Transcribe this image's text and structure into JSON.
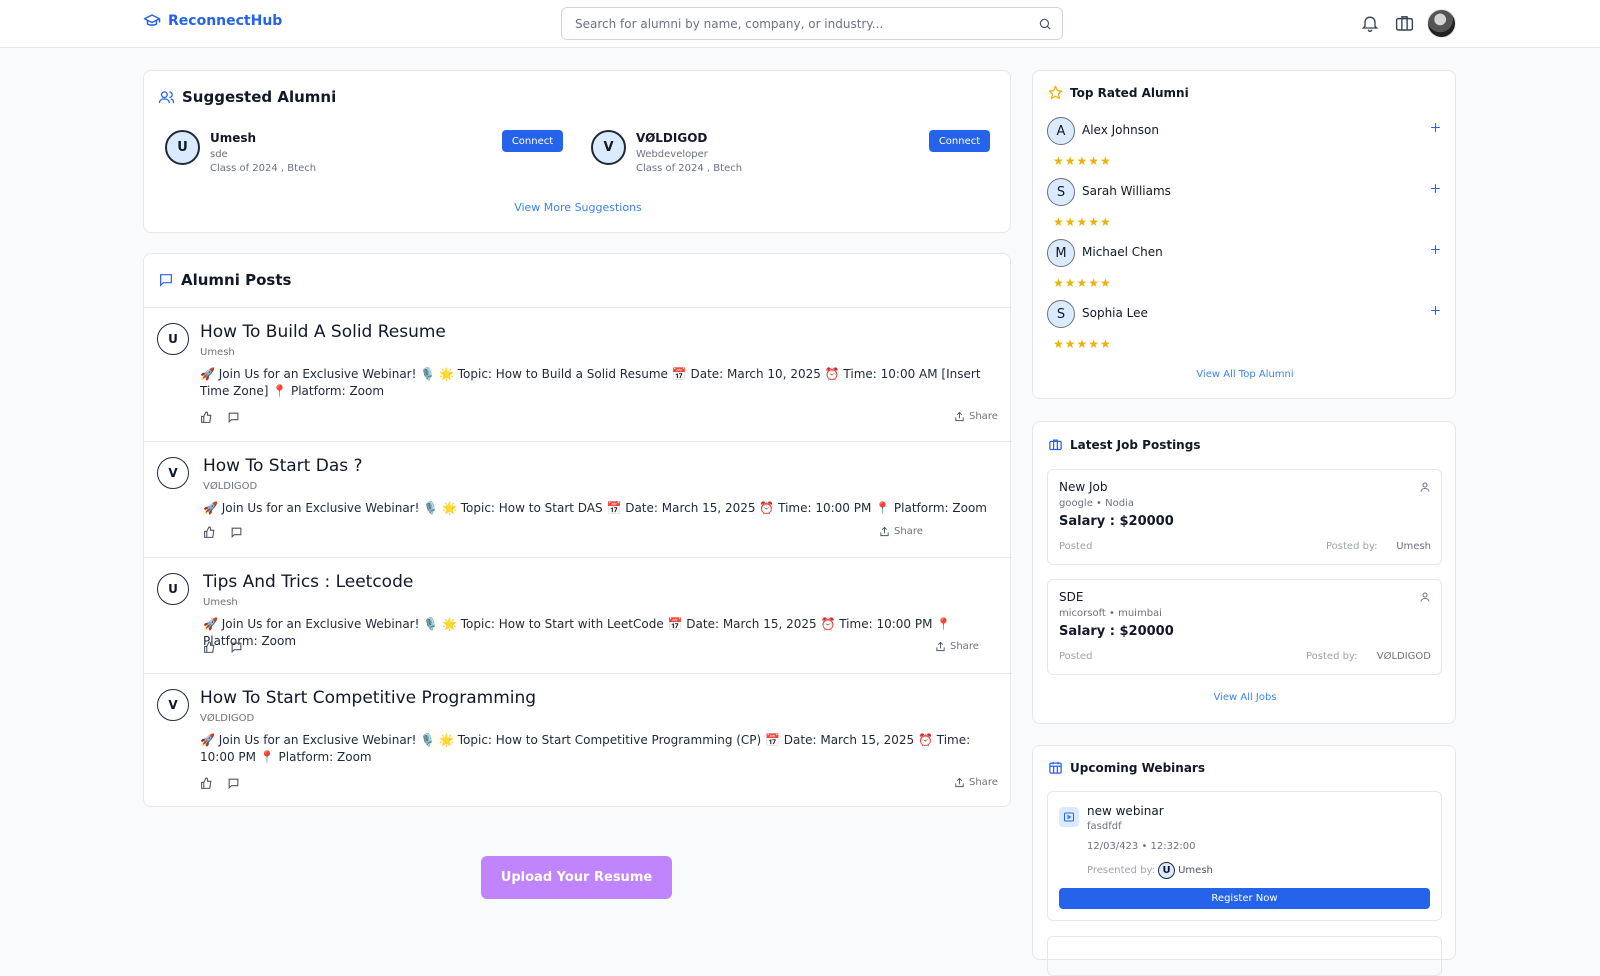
{
  "header": {
    "brand": "ReconnectHub",
    "search_placeholder": "Search for alumni by name, company, or industry..."
  },
  "suggested": {
    "title": "Suggested Alumni",
    "connect_label": "Connect",
    "view_more": "View More Suggestions",
    "items": [
      {
        "initial": "U",
        "name": "Umesh",
        "role": "sde",
        "meta": "Class of 2024 , Btech"
      },
      {
        "initial": "V",
        "name": "VØLDIGOD",
        "role": "Webdeveloper",
        "meta": "Class of 2024 , Btech"
      }
    ]
  },
  "posts": {
    "title": "Alumni Posts",
    "share_label": "Share",
    "items": [
      {
        "initial": "U",
        "title": "How To Build A Solid Resume",
        "author": "Umesh",
        "body": "🚀 Join Us for an Exclusive Webinar! 🎙️ 🌟 Topic: How to Build a Solid Resume 📅 Date: March 10, 2025 ⏰ Time: 10:00 AM [Insert Time Zone] 📍 Platform: Zoom"
      },
      {
        "initial": "V",
        "title": "How To Start Das ?",
        "author": "VØLDIGOD",
        "body": "🚀 Join Us for an Exclusive Webinar! 🎙️ 🌟 Topic: How to Start DAS 📅 Date: March 15, 2025 ⏰ Time: 10:00 PM 📍 Platform: Zoom"
      },
      {
        "initial": "U",
        "title": "Tips And Trics : Leetcode",
        "author": "Umesh",
        "body": "🚀 Join Us for an Exclusive Webinar! 🎙️ 🌟 Topic: How to Start with LeetCode 📅 Date: March 15, 2025 ⏰ Time: 10:00 PM 📍 Platform: Zoom"
      },
      {
        "initial": "V",
        "title": "How To Start Competitive Programming",
        "author": "VØLDIGOD",
        "body": "🚀 Join Us for an Exclusive Webinar! 🎙️ 🌟 Topic: How to Start Competitive Programming (CP) 📅 Date: March 15, 2025 ⏰ Time: 10:00 PM 📍 Platform: Zoom"
      }
    ]
  },
  "upload_label": "Upload Your Resume",
  "top_rated": {
    "title": "Top Rated Alumni",
    "view_all": "View All Top Alumni",
    "stars": "★★★★★",
    "items": [
      {
        "initial": "A",
        "name": "Alex Johnson"
      },
      {
        "initial": "S",
        "name": "Sarah Williams"
      },
      {
        "initial": "M",
        "name": "Michael Chen"
      },
      {
        "initial": "S",
        "name": "Sophia Lee"
      }
    ]
  },
  "jobs": {
    "title": "Latest Job Postings",
    "view_all": "View All Jobs",
    "posted": "Posted",
    "posted_by": "Posted by:",
    "items": [
      {
        "title": "New Job",
        "sub": "google • Nodia",
        "salary": "Salary : $20000",
        "poster": "Umesh"
      },
      {
        "title": "SDE",
        "sub": "micorsoft • muimbai",
        "salary": "Salary : $20000",
        "poster": "VØLDIGOD"
      }
    ]
  },
  "webinars": {
    "title": "Upcoming Webinars",
    "item": {
      "title": "new webinar",
      "sub": "fasdfdf",
      "datetime": "12/03/423 • 12:32:00",
      "presented_by": "Presented by:",
      "presenter_initial": "U",
      "presenter": "Umesh"
    },
    "register": "Register Now"
  },
  "colors": {
    "primary": "#2563eb",
    "upload": "#c084fc",
    "star": "#eab308"
  }
}
